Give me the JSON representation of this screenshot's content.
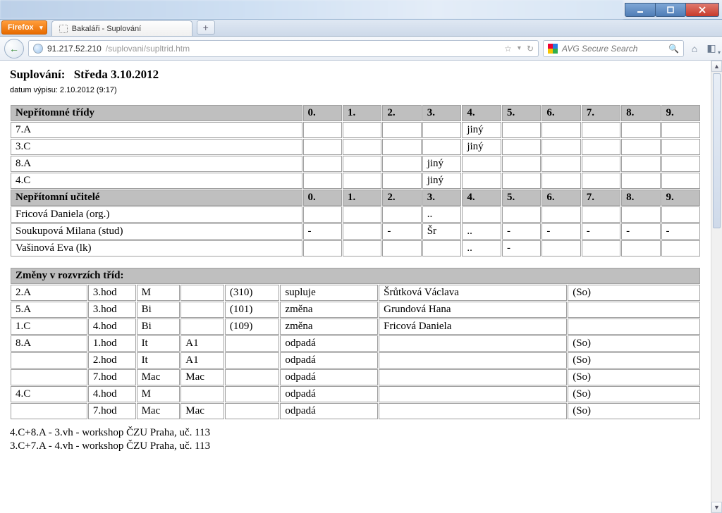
{
  "window": {
    "browser_button": "Firefox",
    "tab_title": "Bakaláři - Suplování",
    "url_host": "91.217.52.210",
    "url_path": "/suplovani/supltrid.htm",
    "search_placeholder": "AVG Secure Search"
  },
  "page": {
    "heading_label": "Suplování:",
    "heading_date": "Středa 3.10.2012",
    "print_info": "datum výpisu: 2.10.2012 (9:17)"
  },
  "absent_classes": {
    "header_label": "Nepřítomné třídy",
    "periods": [
      "0.",
      "1.",
      "2.",
      "3.",
      "4.",
      "5.",
      "6.",
      "7.",
      "8.",
      "9."
    ],
    "rows": [
      {
        "name": "7.A",
        "cells": [
          "",
          "",
          "",
          "",
          "jiný",
          "",
          "",
          "",
          "",
          ""
        ]
      },
      {
        "name": "3.C",
        "cells": [
          "",
          "",
          "",
          "",
          "jiný",
          "",
          "",
          "",
          "",
          ""
        ]
      },
      {
        "name": "8.A",
        "cells": [
          "",
          "",
          "",
          "jiný",
          "",
          "",
          "",
          "",
          "",
          ""
        ]
      },
      {
        "name": "4.C",
        "cells": [
          "",
          "",
          "",
          "jiný",
          "",
          "",
          "",
          "",
          "",
          ""
        ]
      }
    ]
  },
  "absent_teachers": {
    "header_label": "Nepřítomní učitelé",
    "periods": [
      "0.",
      "1.",
      "2.",
      "3.",
      "4.",
      "5.",
      "6.",
      "7.",
      "8.",
      "9."
    ],
    "rows": [
      {
        "name": "Fricová Daniela (org.)",
        "cells": [
          "",
          "",
          "",
          "..",
          "",
          "",
          "",
          "",
          "",
          ""
        ]
      },
      {
        "name": "Soukupová Milana (stud)",
        "cells": [
          "-",
          "",
          "-",
          "Šr",
          "..",
          "-",
          "-",
          "-",
          "-",
          "-"
        ]
      },
      {
        "name": "Vašinová Eva (lk)",
        "cells": [
          "",
          "",
          "",
          "",
          "..",
          "-",
          "",
          "",
          "",
          ""
        ]
      }
    ]
  },
  "changes": {
    "header_label": "Změny v rozvrzích tříd:",
    "rows": [
      {
        "c": [
          "2.A",
          "3.hod",
          "M",
          "",
          "(310)",
          "supluje",
          "Šrůtková Václava",
          "(So)"
        ]
      },
      {
        "c": [
          "5.A",
          "3.hod",
          "Bi",
          "",
          "(101)",
          "změna",
          "Grundová Hana",
          ""
        ]
      },
      {
        "c": [
          "1.C",
          "4.hod",
          "Bi",
          "",
          "(109)",
          "změna",
          "Fricová Daniela",
          ""
        ]
      },
      {
        "c": [
          "8.A",
          "1.hod",
          "It",
          "A1",
          "",
          "odpadá",
          "",
          "(So)"
        ]
      },
      {
        "c": [
          "",
          "2.hod",
          "It",
          "A1",
          "",
          "odpadá",
          "",
          "(So)"
        ]
      },
      {
        "c": [
          "",
          "7.hod",
          "Mac",
          "Mac",
          "",
          "odpadá",
          "",
          "(So)"
        ]
      },
      {
        "c": [
          "4.C",
          "4.hod",
          "M",
          "",
          "",
          "odpadá",
          "",
          "(So)"
        ]
      },
      {
        "c": [
          "",
          "7.hod",
          "Mac",
          "Mac",
          "",
          "odpadá",
          "",
          "(So)"
        ]
      }
    ]
  },
  "notes": [
    "4.C+8.A - 3.vh - workshop ČZU Praha, uč. 113",
    "3.C+7.A - 4.vh - workshop ČZU Praha, uč. 113"
  ]
}
